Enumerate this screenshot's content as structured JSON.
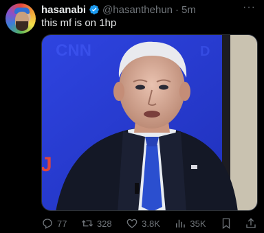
{
  "tweet": {
    "display_name": "hasanabi",
    "handle": "@hasanthehun",
    "separator": "·",
    "time": "5m",
    "text": "this mf is on 1hp",
    "more_icon": "more-icon"
  },
  "actions": {
    "replies": "77",
    "reposts": "328",
    "likes": "3.8K",
    "views": "35K"
  },
  "colors": {
    "background": "#000000",
    "text": "#e7e9ea",
    "muted": "#71767b",
    "verified": "#1d9bf0",
    "media_blue": "#2a3fd6"
  }
}
